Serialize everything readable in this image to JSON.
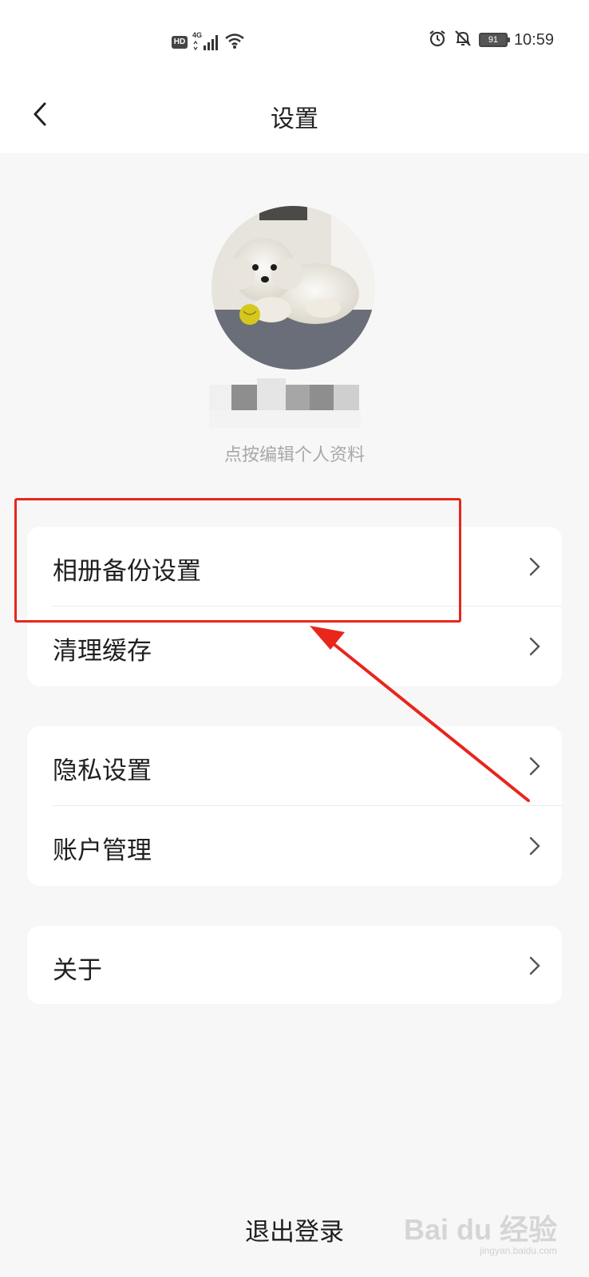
{
  "status_bar": {
    "hd_label": "HD",
    "network_label": "4G",
    "battery_level": "91",
    "time": "10:59",
    "icons": [
      "hd-icon",
      "signal-4g-icon",
      "wifi-icon",
      "alarm-icon",
      "mute-bell-icon",
      "battery-icon"
    ]
  },
  "header": {
    "title": "设置",
    "back_icon": "chevron-left-icon"
  },
  "profile": {
    "edit_hint": "点按编辑个人资料"
  },
  "groups": [
    {
      "items": [
        {
          "label": "相册备份设置"
        },
        {
          "label": "清理缓存"
        }
      ]
    },
    {
      "items": [
        {
          "label": "隐私设置"
        },
        {
          "label": "账户管理"
        }
      ]
    },
    {
      "items": [
        {
          "label": "关于"
        }
      ]
    }
  ],
  "logout_label": "退出登录",
  "watermark": {
    "brand": "Bai du 经验",
    "url": "jingyan.baidu.com"
  },
  "colors": {
    "background": "#f7f7f7",
    "card": "#ffffff",
    "annotation_red": "#e8261c",
    "hint_text": "#a8a8a8"
  }
}
